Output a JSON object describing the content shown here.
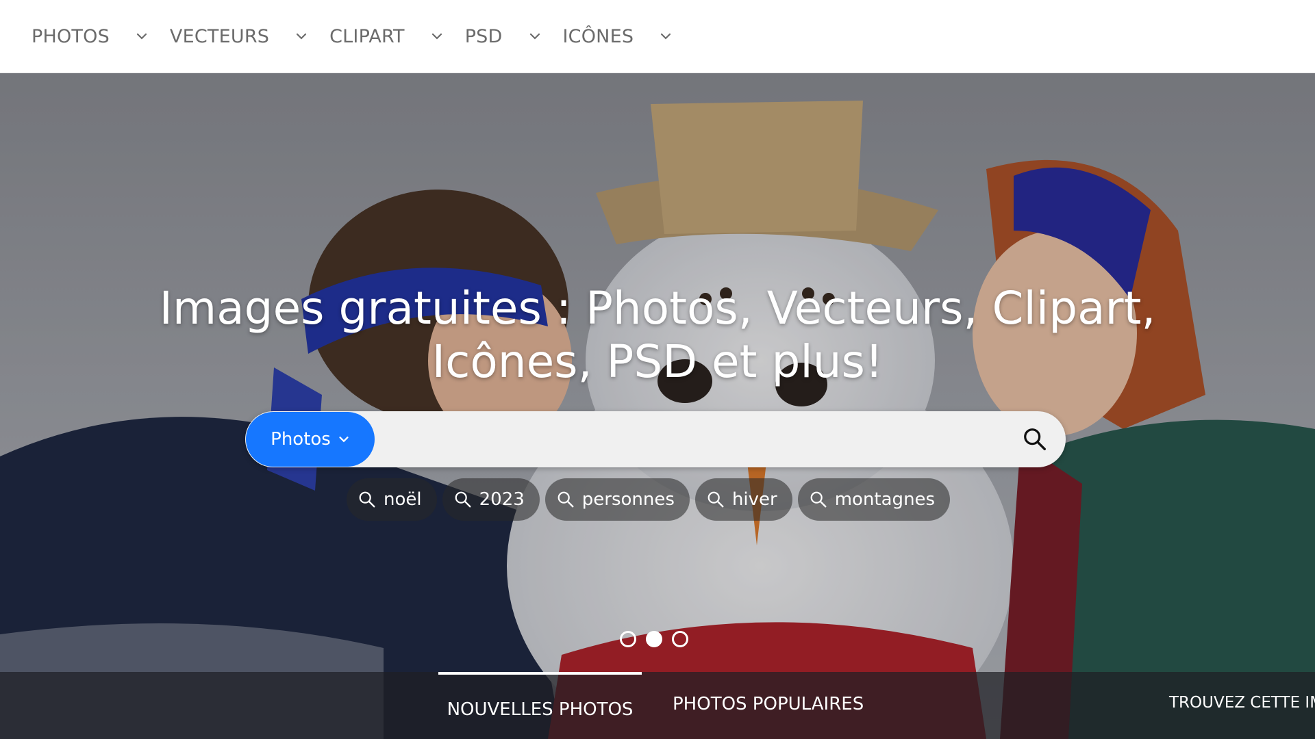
{
  "nav": {
    "items": [
      {
        "label": "PHOTOS"
      },
      {
        "label": "VECTEURS"
      },
      {
        "label": "CLIPART"
      },
      {
        "label": "PSD"
      },
      {
        "label": "ICÔNES"
      }
    ]
  },
  "hero": {
    "title": "Images gratuites : Photos, Vecteurs, Clipart, Icônes, PSD et plus!",
    "search": {
      "type_label": "Photos",
      "value": "",
      "placeholder": ""
    },
    "tags": [
      "noël",
      "2023",
      "personnes",
      "hiver",
      "montagnes"
    ],
    "carousel": {
      "count": 3,
      "active_index": 1
    }
  },
  "tabs": {
    "new_photos": "NOUVELLES PHOTOS",
    "popular_photos": "PHOTOS POPULAIRES",
    "find_image": "TROUVEZ CETTE IM..."
  },
  "colors": {
    "accent": "#1677ff",
    "nav_text": "#6b6b6b"
  },
  "icons": {
    "nav_chevron": "chevron-down-icon",
    "search": "search-icon"
  }
}
